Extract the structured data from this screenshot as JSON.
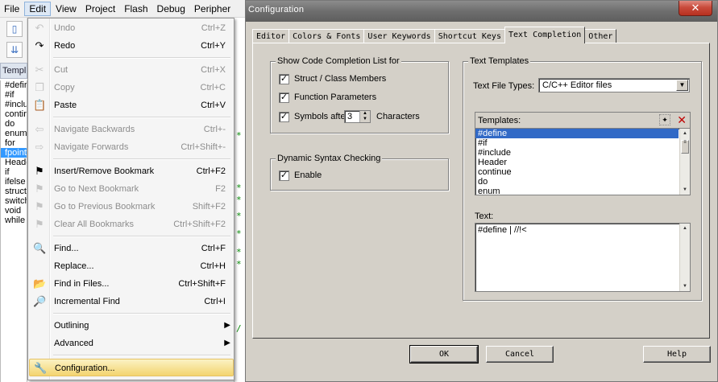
{
  "menubar": [
    "File",
    "Edit",
    "View",
    "Project",
    "Flash",
    "Debug",
    "Peripher"
  ],
  "background": {
    "templates_tab": "Templ",
    "list_items": [
      "#defir",
      "#if",
      "#inclu",
      "contir",
      "do",
      "enum",
      "for",
      "fpointe",
      "Heade",
      "if",
      "ifelse",
      "struct",
      "switch",
      "void",
      "while"
    ],
    "selected_index": 7
  },
  "edit_menu": {
    "items": [
      {
        "label": "Undo",
        "shortcut": "Ctrl+Z",
        "icon": "undo-icon",
        "glyph": "↶",
        "disabled": true
      },
      {
        "label": "Redo",
        "shortcut": "Ctrl+Y",
        "icon": "redo-icon",
        "glyph": "↷",
        "disabled": false
      },
      {
        "label": "Cut",
        "shortcut": "Ctrl+X",
        "icon": "scissors-icon",
        "glyph": "✂",
        "disabled": true
      },
      {
        "label": "Copy",
        "shortcut": "Ctrl+C",
        "icon": "copy-icon",
        "glyph": "❐",
        "disabled": true
      },
      {
        "label": "Paste",
        "shortcut": "Ctrl+V",
        "icon": "paste-icon",
        "glyph": "📋",
        "disabled": false
      },
      {
        "label": "Navigate Backwards",
        "shortcut": "Ctrl+-",
        "icon": "arrow-left-icon",
        "glyph": "⇦",
        "disabled": true
      },
      {
        "label": "Navigate Forwards",
        "shortcut": "Ctrl+Shift+-",
        "icon": "arrow-right-icon",
        "glyph": "⇨",
        "disabled": true
      },
      {
        "label": "Insert/Remove Bookmark",
        "shortcut": "Ctrl+F2",
        "icon": "bookmark-flag-icon",
        "glyph": "⚑",
        "disabled": false
      },
      {
        "label": "Go to Next Bookmark",
        "shortcut": "F2",
        "icon": "next-bookmark-icon",
        "glyph": "⚑",
        "disabled": true
      },
      {
        "label": "Go to Previous Bookmark",
        "shortcut": "Shift+F2",
        "icon": "previous-bookmark-icon",
        "glyph": "⚑",
        "disabled": true
      },
      {
        "label": "Clear All Bookmarks",
        "shortcut": "Ctrl+Shift+F2",
        "icon": "clear-bookmarks-icon",
        "glyph": "⚑",
        "disabled": true
      },
      {
        "label": "Find...",
        "shortcut": "Ctrl+F",
        "icon": "find-icon",
        "glyph": "🔍",
        "disabled": false
      },
      {
        "label": "Replace...",
        "shortcut": "Ctrl+H",
        "icon": "",
        "glyph": "",
        "disabled": false
      },
      {
        "label": "Find in Files...",
        "shortcut": "Ctrl+Shift+F",
        "icon": "find-in-files-icon",
        "glyph": "📂",
        "disabled": false
      },
      {
        "label": "Incremental Find",
        "shortcut": "Ctrl+I",
        "icon": "incremental-find-icon",
        "glyph": "🔎",
        "disabled": false
      },
      {
        "label": "Outlining",
        "shortcut": "",
        "icon": "",
        "glyph": "",
        "disabled": false,
        "submenu": true
      },
      {
        "label": "Advanced",
        "shortcut": "",
        "icon": "",
        "glyph": "",
        "disabled": false,
        "submenu": true
      },
      {
        "label": "Configuration...",
        "shortcut": "",
        "icon": "wrench-icon",
        "glyph": "🔧",
        "disabled": false,
        "highlighted": true
      }
    ]
  },
  "dialog": {
    "title": "Configuration",
    "close_glyph": "✕",
    "tabs": [
      "Editor",
      "Colors & Fonts",
      "User Keywords",
      "Shortcut Keys",
      "Text Completion",
      "Other"
    ],
    "active_tab": 4,
    "show_code_completion": {
      "title": "Show Code Completion List for",
      "struct_members": "Struct / Class Members",
      "function_parameters": "Function Parameters",
      "symbols_after": "Symbols after",
      "symbols_count": "3",
      "characters": "Characters"
    },
    "dynamic_syntax": {
      "title": "Dynamic Syntax Checking",
      "enable": "Enable"
    },
    "text_templates": {
      "title": "Text Templates",
      "file_type_label": "Text File Types:",
      "file_type_value": "C/C++ Editor files",
      "templates_label": "Templates:",
      "templates": [
        "#define",
        "#if",
        "#include",
        "Header",
        "continue",
        "do",
        "enum"
      ],
      "selected_template": 0,
      "text_label": "Text:",
      "text_value": "#define | //!<"
    },
    "buttons": {
      "ok": "OK",
      "cancel": "Cancel",
      "help": "Help"
    }
  }
}
